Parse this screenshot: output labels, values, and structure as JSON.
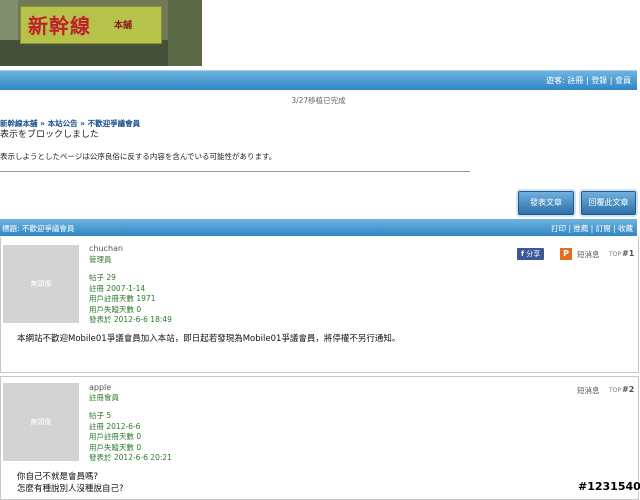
{
  "banner": {
    "logo": "新幹線",
    "logo_sub": "本舖"
  },
  "topbar": {
    "guest_label": "遊客:",
    "register": "註冊",
    "login": "登錄",
    "members": "會員"
  },
  "announcement": "3/27移植已完成",
  "breadcrumb": "新幹線本舖 » 本站公告 » 不歡迎爭議會員",
  "blocked": {
    "title": "表示をブロックしました",
    "message": "表示しようとしたページは公序良俗に反する内容を含んでいる可能性があります。"
  },
  "actions": {
    "new_post": "發表文章",
    "reply": "回覆此文章"
  },
  "thread": {
    "title": "標題: 不歡迎爭議會員",
    "tools": [
      "打印",
      "推薦",
      "訂閱",
      "收藏"
    ]
  },
  "posts": [
    {
      "avatar_text": "無頭像",
      "username": "chuchan",
      "role": "管理員",
      "stats": [
        "帖子 29",
        "註冊 2007-1-14",
        "用戶註冊天數 1971",
        "用戶失蹤天數 0",
        "發表於 2012-6-6 18:49"
      ],
      "body": "本網站不歡迎Mobile01爭議會員加入本站，即日起若發現為Mobile01爭議會員，將停權不另行通知。",
      "share_label": "分享",
      "pm_label": "短消息",
      "top_label": "TOP",
      "floor": "#1"
    },
    {
      "avatar_text": "無頭像",
      "username": "apple",
      "role": "註冊會員",
      "stats": [
        "帖子 5",
        "註冊 2012-6-6",
        "用戶註冊天數 0",
        "用戶失蹤天數 0",
        "發表於 2012-6-6 20:21"
      ],
      "body_lines": [
        "你自己不就是會員嗎?",
        "怎麼有種說別人沒種說自己?"
      ],
      "pm_label": "短消息",
      "top_label": "TOP",
      "floor": "#2"
    }
  ],
  "watermark": "#1231540",
  "colors": {
    "bar_top": "#6fb4e0",
    "bar_bottom": "#2f86c4",
    "link": "#1b4f8a",
    "stats_green": "#2d7a2d"
  }
}
